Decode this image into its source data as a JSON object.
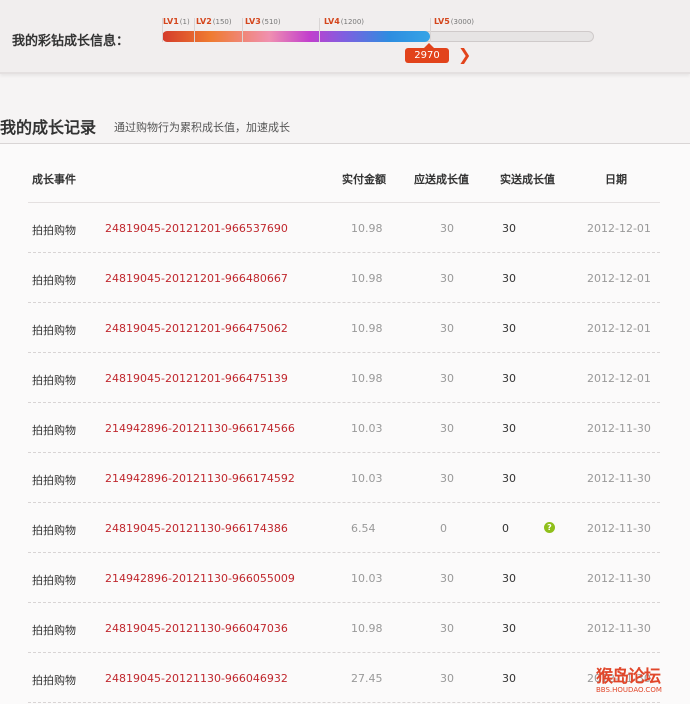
{
  "growth": {
    "label": "我的彩钻成长信息：",
    "levels": [
      {
        "name": "LV1",
        "value": "(1)"
      },
      {
        "name": "LV2",
        "value": "(150)"
      },
      {
        "name": "LV3",
        "value": "(510)"
      },
      {
        "name": "LV4",
        "value": "(1200)"
      },
      {
        "name": "LV5",
        "value": "(3000)"
      }
    ],
    "current": "2970",
    "progress_fraction": 0.99
  },
  "section": {
    "title": "我的成长记录",
    "subtitle": "通过购物行为累积成长值，加速成长"
  },
  "table": {
    "headers": {
      "event": "成长事件",
      "amount": "实付金额",
      "should": "应送成长值",
      "real": "实送成长值",
      "date": "日期"
    },
    "rows": [
      {
        "event": "拍拍购物",
        "order": "24819045-20121201-966537690",
        "amount": "10.98",
        "should": "30",
        "real": "30",
        "date": "2012-12-01"
      },
      {
        "event": "拍拍购物",
        "order": "24819045-20121201-966480667",
        "amount": "10.98",
        "should": "30",
        "real": "30",
        "date": "2012-12-01"
      },
      {
        "event": "拍拍购物",
        "order": "24819045-20121201-966475062",
        "amount": "10.98",
        "should": "30",
        "real": "30",
        "date": "2012-12-01"
      },
      {
        "event": "拍拍购物",
        "order": "24819045-20121201-966475139",
        "amount": "10.98",
        "should": "30",
        "real": "30",
        "date": "2012-12-01"
      },
      {
        "event": "拍拍购物",
        "order": "214942896-20121130-966174566",
        "amount": "10.03",
        "should": "30",
        "real": "30",
        "date": "2012-11-30"
      },
      {
        "event": "拍拍购物",
        "order": "214942896-20121130-966174592",
        "amount": "10.03",
        "should": "30",
        "real": "30",
        "date": "2012-11-30"
      },
      {
        "event": "拍拍购物",
        "order": "24819045-20121130-966174386",
        "amount": "6.54",
        "should": "0",
        "real": "0",
        "date": "2012-11-30",
        "help_icon": "question-icon"
      },
      {
        "event": "拍拍购物",
        "order": "214942896-20121130-966055009",
        "amount": "10.03",
        "should": "30",
        "real": "30",
        "date": "2012-11-30"
      },
      {
        "event": "拍拍购物",
        "order": "24819045-20121130-966047036",
        "amount": "10.98",
        "should": "30",
        "real": "30",
        "date": "2012-11-30"
      },
      {
        "event": "拍拍购物",
        "order": "24819045-20121130-966046932",
        "amount": "27.45",
        "should": "30",
        "real": "30",
        "date": "2012-11-30"
      }
    ]
  },
  "watermark": {
    "main": "猴岛论坛",
    "sub": "BBS.HOUDAO.COM"
  },
  "colors": {
    "accent": "#e2431b",
    "order_link": "#c0282e"
  }
}
